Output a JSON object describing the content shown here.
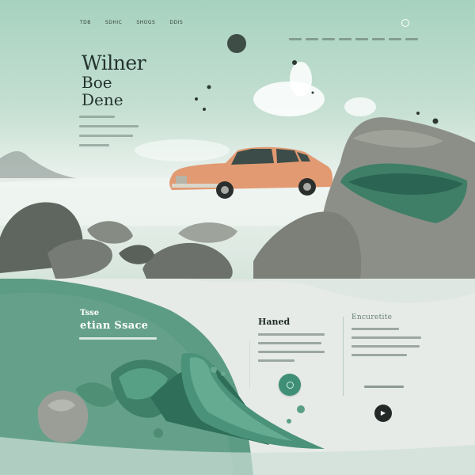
{
  "nav": {
    "items": [
      "TDB",
      "SDHIC",
      "SHOGS",
      "DDIS"
    ]
  },
  "hero": {
    "title_line1": "Wilner",
    "title_line2": "Boe",
    "title_line3": "Dene"
  },
  "section": {
    "caption_small": "Tsse",
    "caption_big": "etian Ssace"
  },
  "columns": [
    {
      "heading": "Haned"
    },
    {
      "heading": "Encuretite"
    }
  ],
  "icons": {
    "nav_circle": "circle-outline-icon",
    "action_a": "circle-outline-icon",
    "action_b": "chevron-right-icon"
  },
  "colors": {
    "accent_green": "#3f8f76",
    "car": "#e29a72",
    "dark_button": "#232927"
  }
}
